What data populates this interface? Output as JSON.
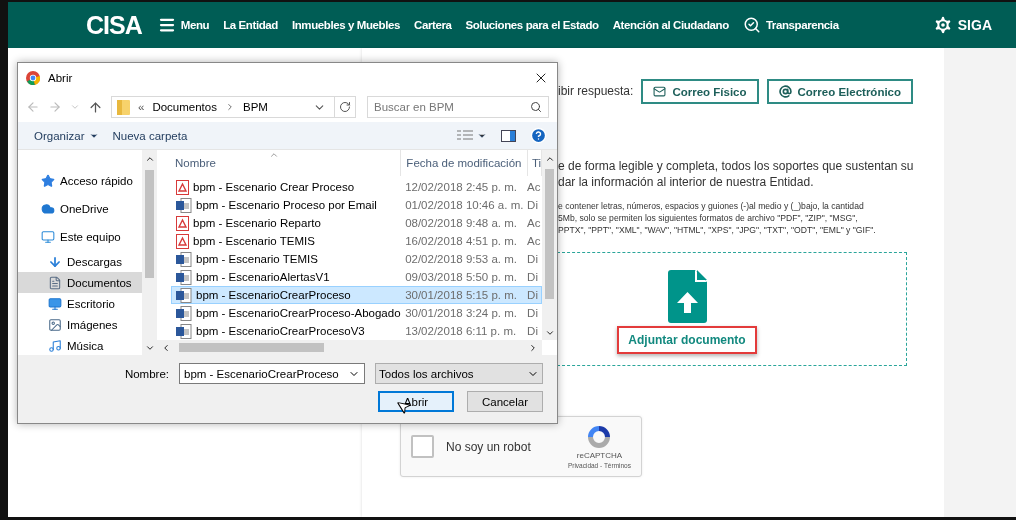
{
  "header": {
    "logo": "CISA",
    "menu_label": "Menu",
    "nav": [
      "La Entidad",
      "Inmuebles y Muebles",
      "Cartera",
      "Soluciones para el Estado",
      "Atención al Ciudadano"
    ],
    "transparency": "Transparencia",
    "brand": "SIGA"
  },
  "form": {
    "response_label": "ibir respuesta:",
    "response_options": [
      {
        "kind": "mail",
        "label": "Correo Físico"
      },
      {
        "kind": "at",
        "label": "Correo Electrónico"
      }
    ],
    "paragraph": [
      "e de forma legible y completa, todos los soportes que sustentan su",
      "dar la información al interior de nuestra Entidad."
    ],
    "note_lines": [
      "e contener letras, números, espacios y guiones (-)al medio y (_)bajo, la cantidad",
      "5Mb, solo se permiten los siguientes formatos de archivo \"PDF\", \"ZIP\", \"MSG\",",
      "PPTX\", \"PPT\", \"XML\", \"WAV\", \"HTML\", \"XPS\", \"JPG\", \"TXT\", \"ODT\", \"EML\" y \"GIF\"."
    ],
    "upload": {
      "label": "Adjuntar documento",
      "highlighted": true
    },
    "captcha": {
      "label": "No soy un robot",
      "checked": false,
      "brand": "reCAPTCHA",
      "links": "Privacidad - Términos"
    }
  },
  "dialog": {
    "title": "Abrir",
    "path_prefix": "«",
    "path": [
      "Documentos",
      "BPM"
    ],
    "search_placeholder": "Buscar en BPM",
    "toolbar": {
      "organize": "Organizar",
      "new_folder": "Nueva carpeta"
    },
    "nav": [
      {
        "kind": "star",
        "label": "Acceso rápido",
        "selected": false
      },
      {
        "kind": "cloud",
        "label": "OneDrive",
        "selected": false
      },
      {
        "kind": "pc",
        "label": "Este equipo",
        "selected": false,
        "children": [
          {
            "kind": "download",
            "label": "Descargas",
            "selected": false
          },
          {
            "kind": "docs",
            "label": "Documentos",
            "selected": true
          },
          {
            "kind": "desktop",
            "label": "Escritorio",
            "selected": false
          },
          {
            "kind": "images",
            "label": "Imágenes",
            "selected": false
          },
          {
            "kind": "music",
            "label": "Música",
            "selected": false
          }
        ]
      }
    ],
    "columns": [
      "Nombre",
      "Fecha de modificación",
      "Ti"
    ],
    "files": [
      {
        "kind": "pdf",
        "name": "bpm - Escenario Crear Proceso",
        "date": "12/02/2018 2:45 p. m.",
        "type": "Ac",
        "selected": false
      },
      {
        "kind": "word",
        "name": "bpm - Escenario Proceso por Email",
        "date": "01/02/2018 10:46 a. m.",
        "type": "Di",
        "selected": false
      },
      {
        "kind": "pdf",
        "name": "bpm - Escenario Reparto",
        "date": "08/02/2018 9:48 a. m.",
        "type": "Ac",
        "selected": false
      },
      {
        "kind": "pdf",
        "name": "bpm - Escenario TEMIS",
        "date": "16/02/2018 4:51 p. m.",
        "type": "Ac",
        "selected": false
      },
      {
        "kind": "word",
        "name": "bpm - Escenario TEMIS",
        "date": "02/02/2018 9:53 a. m.",
        "type": "Di",
        "selected": false
      },
      {
        "kind": "word",
        "name": "bpm - EscenarioAlertasV1",
        "date": "09/03/2018 5:50 p. m.",
        "type": "Di",
        "selected": false
      },
      {
        "kind": "word",
        "name": "bpm - EscenarioCrearProceso",
        "date": "30/01/2018 5:15 p. m.",
        "type": "Di",
        "selected": true
      },
      {
        "kind": "word",
        "name": "bpm - EscenarioCrearProceso-Abogado",
        "date": "30/01/2018 3:24 p. m.",
        "type": "Di",
        "selected": false
      },
      {
        "kind": "word",
        "name": "bpm - EscenarioCrearProcesoV3",
        "date": "13/02/2018 6:11 p. m.",
        "type": "Di",
        "selected": false
      }
    ],
    "filename_label": "Nombre:",
    "filename": "bpm - EscenarioCrearProceso",
    "filter": "Todos los archivos",
    "buttons": [
      {
        "label": "Abrir",
        "focused": true
      },
      {
        "label": "Cancelar",
        "focused": false
      }
    ]
  }
}
